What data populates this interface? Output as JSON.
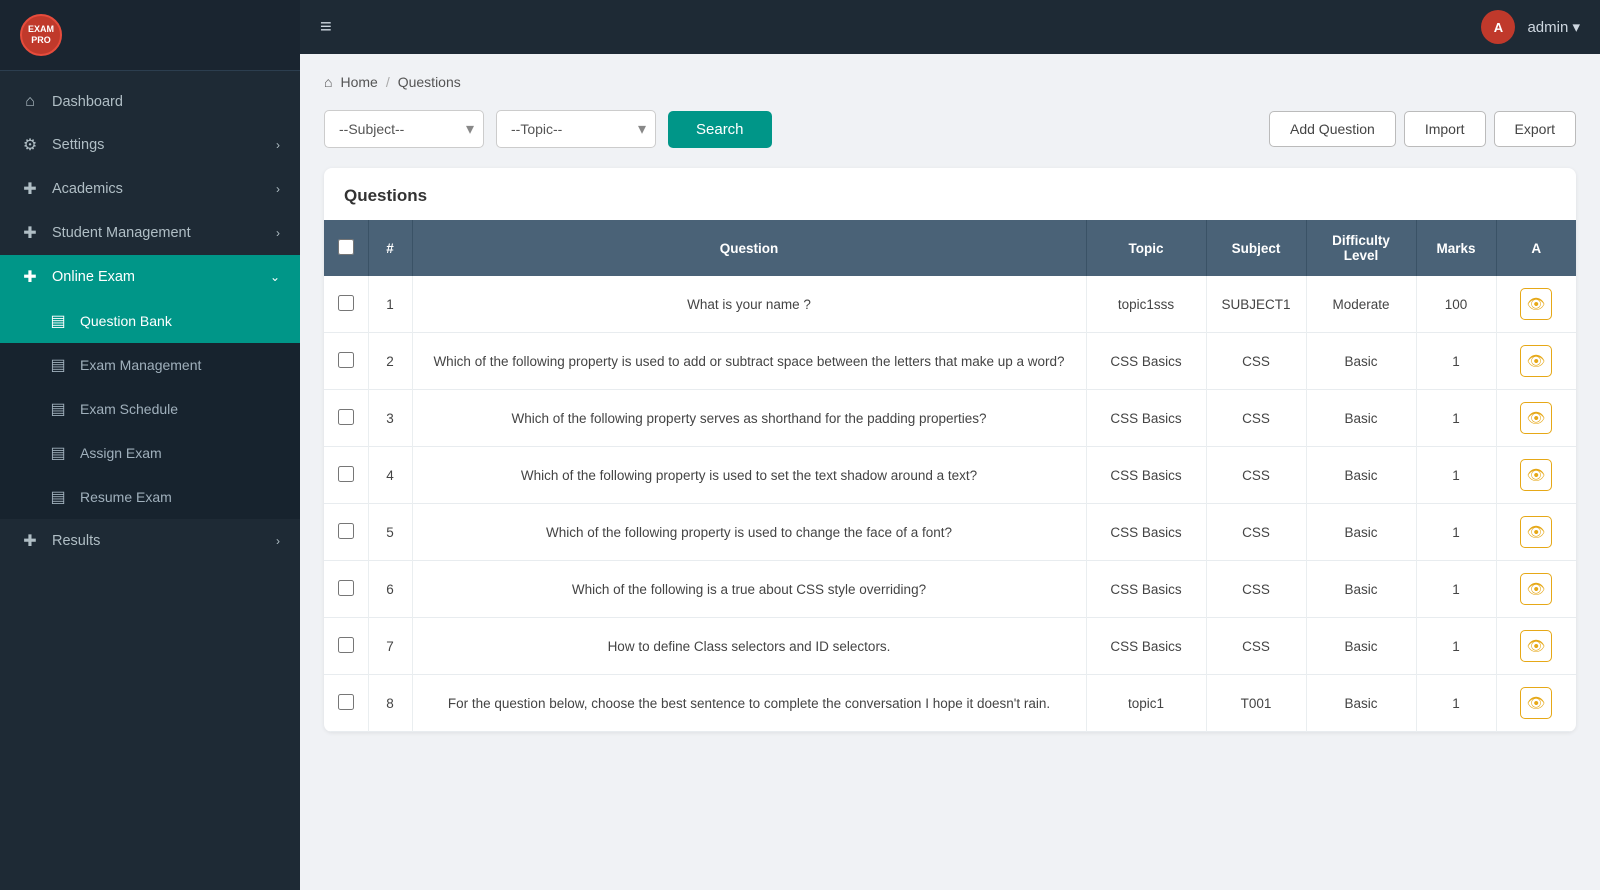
{
  "app": {
    "logo_text": "EXAM PRO",
    "topbar_menu_icon": "≡",
    "admin_label": "admin ▾",
    "admin_initials": "A"
  },
  "sidebar": {
    "items": [
      {
        "id": "dashboard",
        "label": "Dashboard",
        "icon": "⌂",
        "has_arrow": false,
        "active": false
      },
      {
        "id": "settings",
        "label": "Settings",
        "icon": "⚙",
        "has_arrow": true,
        "active": false
      },
      {
        "id": "academics",
        "label": "Academics",
        "icon": "+",
        "has_arrow": true,
        "active": false
      },
      {
        "id": "student-management",
        "label": "Student Management",
        "icon": "+",
        "has_arrow": true,
        "active": false
      },
      {
        "id": "online-exam",
        "label": "Online Exam",
        "icon": "+",
        "has_arrow": true,
        "active": true
      }
    ],
    "online_exam_subitems": [
      {
        "id": "question-bank",
        "label": "Question Bank",
        "icon": "▤",
        "active": true
      },
      {
        "id": "exam-management",
        "label": "Exam Management",
        "icon": "▤",
        "active": false
      },
      {
        "id": "exam-schedule",
        "label": "Exam Schedule",
        "icon": "▤",
        "active": false
      },
      {
        "id": "assign-exam",
        "label": "Assign Exam",
        "icon": "▤",
        "active": false
      },
      {
        "id": "resume-exam",
        "label": "Resume Exam",
        "icon": "▤",
        "active": false
      }
    ],
    "results_item": {
      "id": "results",
      "label": "Results",
      "icon": "+",
      "has_arrow": true,
      "active": false
    }
  },
  "breadcrumb": {
    "home_label": "Home",
    "separator": "/",
    "current": "Questions"
  },
  "filters": {
    "subject_placeholder": "--Subject--",
    "topic_placeholder": "--Topic--",
    "search_label": "Search",
    "add_question_label": "Add Question",
    "import_label": "Import",
    "export_label": "Export"
  },
  "table": {
    "title": "Questions",
    "columns": [
      "#",
      "Question",
      "Topic",
      "Subject",
      "Difficulty Level",
      "Marks",
      "A"
    ],
    "rows": [
      {
        "id": 1,
        "question": "What is your name ?",
        "topic": "topic1sss",
        "subject": "SUBJECT1",
        "difficulty": "Moderate",
        "marks": 100
      },
      {
        "id": 2,
        "question": "Which of the following property is used to add or subtract space between the letters that make up a word?",
        "topic": "CSS Basics",
        "subject": "CSS",
        "difficulty": "Basic",
        "marks": 1
      },
      {
        "id": 3,
        "question": "Which of the following property serves as shorthand for the padding properties?",
        "topic": "CSS Basics",
        "subject": "CSS",
        "difficulty": "Basic",
        "marks": 1
      },
      {
        "id": 4,
        "question": "Which of the following property is used to set the text shadow around a text?",
        "topic": "CSS Basics",
        "subject": "CSS",
        "difficulty": "Basic",
        "marks": 1
      },
      {
        "id": 5,
        "question": "Which of the following property is used to change the face of a font?",
        "topic": "CSS Basics",
        "subject": "CSS",
        "difficulty": "Basic",
        "marks": 1
      },
      {
        "id": 6,
        "question": "Which of the following is a true about CSS style overriding?",
        "topic": "CSS Basics",
        "subject": "CSS",
        "difficulty": "Basic",
        "marks": 1
      },
      {
        "id": 7,
        "question": "How to define Class selectors and ID selectors.",
        "topic": "CSS Basics",
        "subject": "CSS",
        "difficulty": "Basic",
        "marks": 1
      },
      {
        "id": 8,
        "question": "For the question below, choose the best sentence to complete the conversation I hope it doesn't rain.",
        "topic": "topic1",
        "subject": "T001",
        "difficulty": "Basic",
        "marks": 1
      }
    ]
  }
}
